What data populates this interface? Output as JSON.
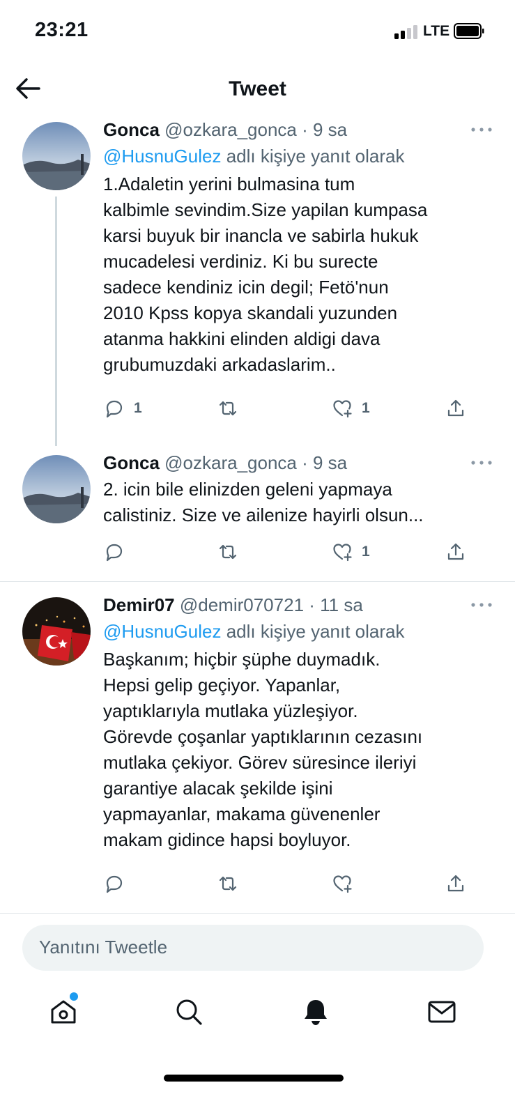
{
  "status_bar": {
    "time": "23:21",
    "network": "LTE"
  },
  "header": {
    "title": "Tweet"
  },
  "tweets": [
    {
      "name": "Gonca",
      "handle_time": "@ozkara_gonca · 9 sa",
      "reply_to_user": "@HusnuGulez",
      "reply_to_suffix": " adlı kişiye yanıt olarak",
      "lines": [
        "1.Adaletin yerini bulmasina tum",
        "kalbimle sevindim.Size yapilan kumpasa",
        "karsi buyuk bir inancla ve sabirla hukuk",
        "mucadelesi verdiniz. Ki bu surecte",
        "sadece kendiniz icin degil; Fetö'nun",
        "2010 Kpss kopya skandali yuzunden",
        "atanma hakkini elinden aldigi dava",
        "grubumuzdaki arkadaslarim.."
      ],
      "reply_count": "1",
      "retweet_count": "",
      "like_count": "1"
    },
    {
      "name": "Gonca",
      "handle_time": "@ozkara_gonca · 9 sa",
      "lines": [
        "2. icin bile elinizden geleni yapmaya",
        "calistiniz. Size ve ailenize hayirli olsun..."
      ],
      "reply_count": "",
      "retweet_count": "",
      "like_count": "1"
    },
    {
      "name": "Demir07",
      "handle_time": "@demir070721 · 11 sa",
      "reply_to_user": "@HusnuGulez",
      "reply_to_suffix": " adlı kişiye yanıt olarak",
      "lines": [
        "Başkanım; hiçbir şüphe duymadık.",
        "Hepsi gelip geçiyor. Yapanlar,",
        "yaptıklarıyla mutlaka yüzleşiyor.",
        "Görevde çoşanlar yaptıklarının cezasını",
        "mutlaka çekiyor. Görev  süresince ileriyi",
        "garantiye alacak şekilde işini",
        "yapmayanlar, makama güvenenler",
        "makam gidince hapsi boyluyor."
      ],
      "reply_count": "",
      "retweet_count": "",
      "like_count": ""
    }
  ],
  "reply_box": {
    "placeholder": "Yanıtını Tweetle"
  },
  "tab_bar": {
    "items": [
      {
        "icon": "home-icon"
      },
      {
        "icon": "search-icon"
      },
      {
        "icon": "bell-icon"
      },
      {
        "icon": "mail-icon"
      }
    ]
  },
  "colors": {
    "accent": "#1d9bf0",
    "secondary_text": "#536471",
    "primary_text": "#0f1419",
    "thread_line": "#cfd9de"
  }
}
